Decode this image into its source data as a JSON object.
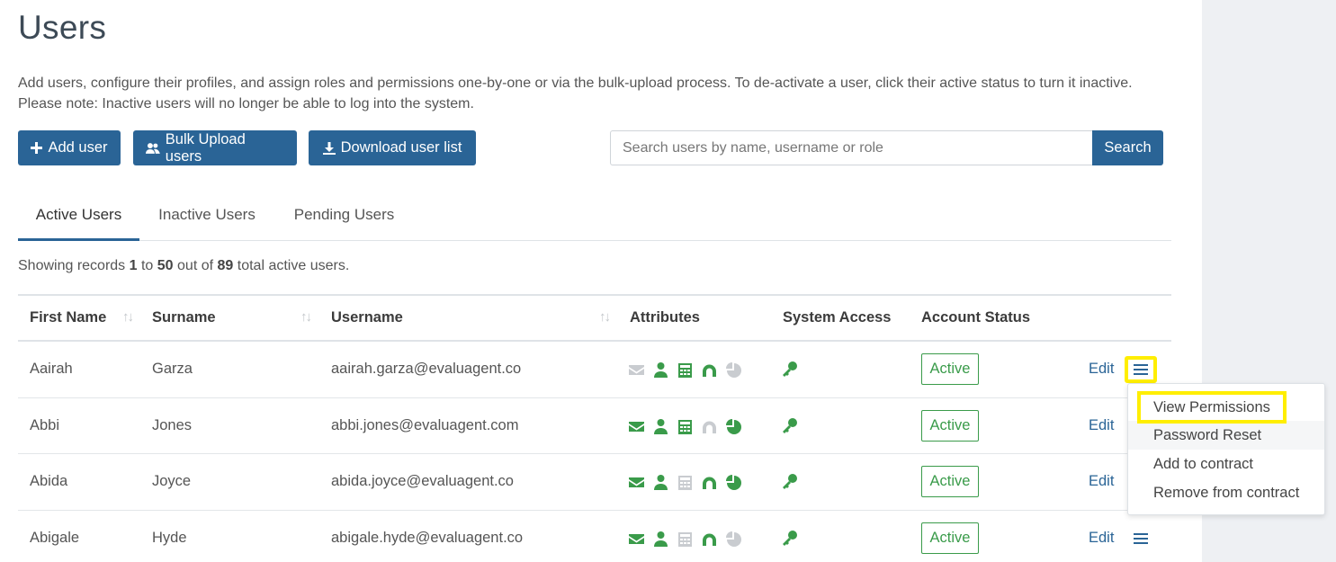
{
  "page": {
    "title": "Users",
    "intro_line1": "Add users, configure their profiles, and assign roles and permissions one-by-one or via the bulk-upload process. To de-activate a user, click their active status to turn it inactive.",
    "intro_line2": "Please note: Inactive users will no longer be able to log into the system."
  },
  "toolbar": {
    "add_user": "Add user",
    "bulk_upload": "Bulk Upload users",
    "download": "Download user list",
    "search_placeholder": "Search users by name, username or role",
    "search_button": "Search"
  },
  "tabs": [
    "Active Users",
    "Inactive Users",
    "Pending Users"
  ],
  "records": {
    "prefix": "Showing records",
    "from": "1",
    "to_word": "to",
    "to": "50",
    "out_of_word": "out of",
    "total": "89",
    "suffix": "total active users."
  },
  "table": {
    "headers": {
      "first_name": "First Name",
      "surname": "Surname",
      "username": "Username",
      "attributes": "Attributes",
      "system_access": "System Access",
      "account_status": "Account Status"
    },
    "sort_icon": "↑↓",
    "rows": [
      {
        "first": "Aairah",
        "surname": "Garza",
        "username": "aairah.garza@evaluagent.co",
        "status": "Active",
        "edit": "Edit",
        "attributes": [
          false,
          true,
          true,
          true,
          false
        ]
      },
      {
        "first": "Abbi",
        "surname": "Jones",
        "username": "abbi.jones@evaluagent.com",
        "status": "Active",
        "edit": "Edit",
        "attributes": [
          true,
          true,
          true,
          false,
          true
        ]
      },
      {
        "first": "Abida",
        "surname": "Joyce",
        "username": "abida.joyce@evaluagent.co",
        "status": "Active",
        "edit": "Edit",
        "attributes": [
          true,
          true,
          false,
          true,
          true
        ]
      },
      {
        "first": "Abigale",
        "surname": "Hyde",
        "username": "abigale.hyde@evaluagent.co",
        "status": "Active",
        "edit": "Edit",
        "attributes": [
          true,
          true,
          false,
          true,
          false
        ]
      }
    ]
  },
  "dropdown": {
    "items": [
      "View Permissions",
      "Password Reset",
      "Add to contract",
      "Remove from contract"
    ]
  },
  "icons": {
    "attribute_icons": [
      "envelope-icon",
      "user-icon",
      "calculator-icon",
      "headset-icon",
      "pie-chart-icon"
    ],
    "system_access_icon": "key-icon",
    "menu_icon": "hamburger-menu-icon"
  },
  "colors": {
    "primary": "#2a6496",
    "active_green": "#3a9b4a",
    "disabled_gray": "#c9ccd0",
    "highlight": "#ffee00"
  }
}
